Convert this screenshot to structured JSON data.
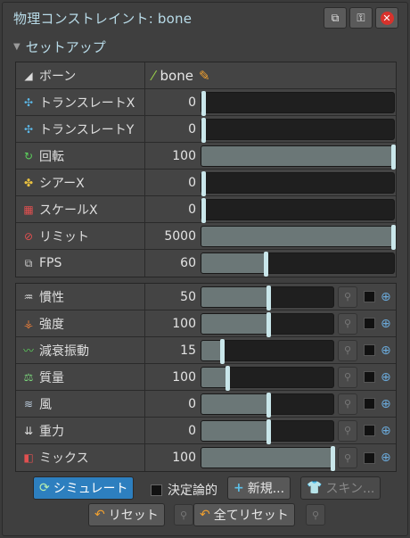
{
  "title": "物理コンストレイント: bone",
  "section": "セットアップ",
  "bone_row": {
    "label": "ボーン",
    "value": "bone"
  },
  "setup_rows": [
    {
      "name": "translate-x",
      "label": "トランスレートX",
      "value": "0",
      "fill": 0.0
    },
    {
      "name": "translate-y",
      "label": "トランスレートY",
      "value": "0",
      "fill": 0.0
    },
    {
      "name": "rotate",
      "label": "回転",
      "value": "100",
      "fill": 1.0
    },
    {
      "name": "shear-x",
      "label": "シアーX",
      "value": "0",
      "fill": 0.0
    },
    {
      "name": "scale-x",
      "label": "スケールX",
      "value": "0",
      "fill": 0.0
    },
    {
      "name": "limit",
      "label": "リミット",
      "value": "5000",
      "fill": 1.0
    },
    {
      "name": "fps",
      "label": "FPS",
      "value": "60",
      "fill": 0.33
    }
  ],
  "physics_rows": [
    {
      "name": "inertia",
      "label": "慣性",
      "value": "50",
      "fill": 0.5
    },
    {
      "name": "strength",
      "label": "強度",
      "value": "100",
      "fill": 0.5
    },
    {
      "name": "damping",
      "label": "減衰振動",
      "value": "15",
      "fill": 0.15
    },
    {
      "name": "mass",
      "label": "質量",
      "value": "100",
      "fill": 0.19
    },
    {
      "name": "wind",
      "label": "風",
      "value": "0",
      "fill": 0.5
    },
    {
      "name": "gravity",
      "label": "重力",
      "value": "0",
      "fill": 0.5
    },
    {
      "name": "mix",
      "label": "ミックス",
      "value": "100",
      "fill": 1.0
    }
  ],
  "buttons": {
    "simulate": "シミュレート",
    "deterministic": "決定論的",
    "new": "新規...",
    "skin": "スキン...",
    "reset": "リセット",
    "reset_all": "全てリセット"
  }
}
